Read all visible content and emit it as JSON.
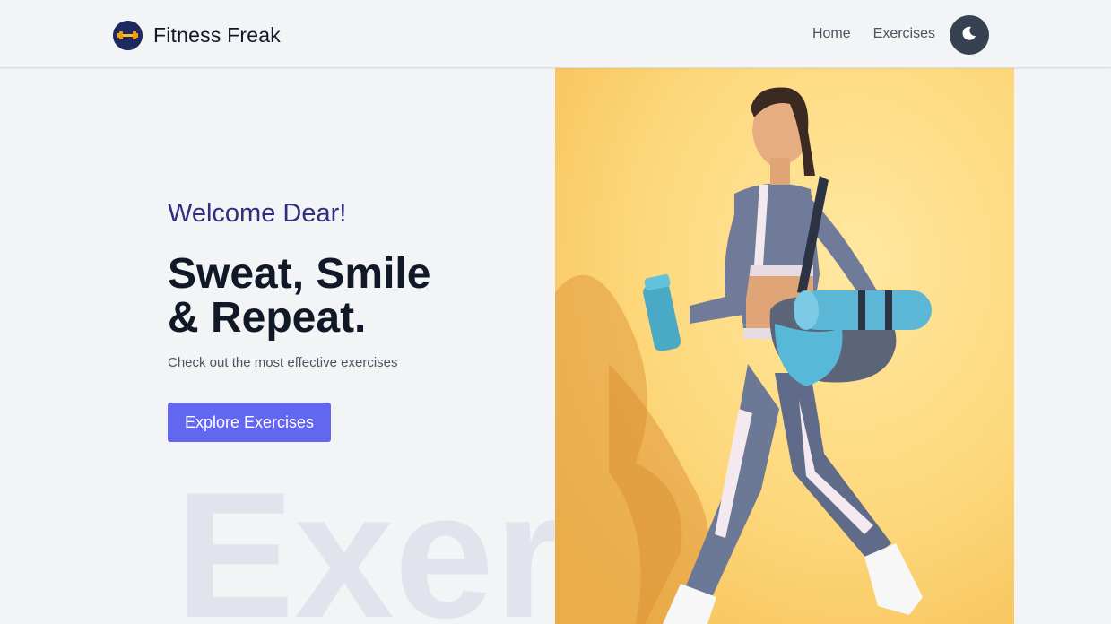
{
  "header": {
    "brand_name": "Fitness Freak",
    "nav": [
      {
        "label": "Home"
      },
      {
        "label": "Exercises"
      }
    ],
    "theme_toggle_icon": "moon-icon"
  },
  "hero": {
    "welcome": "Welcome Dear!",
    "headline_line1": "Sweat, Smile",
    "headline_line2": "& Repeat.",
    "subtext": "Check out the most effective exercises",
    "cta_label": "Explore Exercises",
    "background_word": "Exercises",
    "image_alt": "woman-with-gym-bag-and-yoga-mat"
  },
  "colors": {
    "accent": "#6366f1",
    "welcome_text": "#312e81",
    "toggle_bg": "#374151",
    "image_bg": "#fdd77a"
  }
}
